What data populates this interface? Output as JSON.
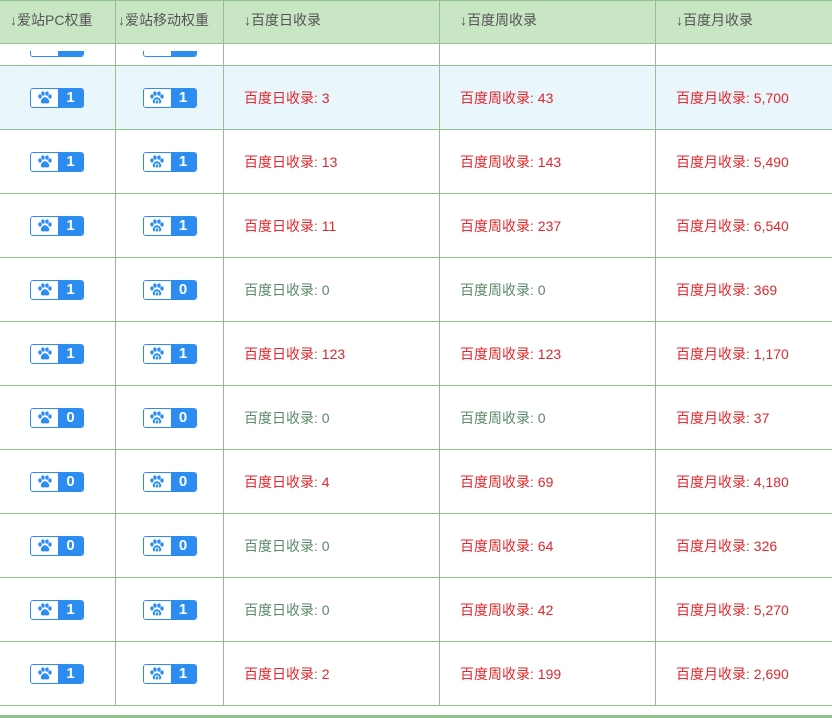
{
  "headers": {
    "pc_weight": "↓爱站PC权重",
    "mobile_weight": "↓爱站移动权重",
    "daily": "↓百度日收录",
    "weekly": "↓百度周收录",
    "monthly": "↓百度月收录"
  },
  "icons": {
    "pc_badge": "paw-icon",
    "mobile_badge": "paw-mobile-icon"
  },
  "colors": {
    "badge_blue": "#2d8cf0",
    "positive_red": "#e0282e",
    "zero_green": "#5a8a6a",
    "header_bg": "#c9e6c4",
    "highlight_bg": "#e9f6fc"
  },
  "rows": [
    {
      "pc": "1",
      "mobile": "1",
      "daily": "百度日收录: 3",
      "weekly": "百度周收录: 43",
      "monthly": "百度月收录: 5,700"
    },
    {
      "pc": "1",
      "mobile": "1",
      "daily": "百度日收录: 13",
      "weekly": "百度周收录: 143",
      "monthly": "百度月收录: 5,490"
    },
    {
      "pc": "1",
      "mobile": "1",
      "daily": "百度日收录: 11",
      "weekly": "百度周收录: 237",
      "monthly": "百度月收录: 6,540"
    },
    {
      "pc": "1",
      "mobile": "0",
      "daily": "百度日收录: 0",
      "weekly": "百度周收录: 0",
      "monthly": "百度月收录: 369"
    },
    {
      "pc": "1",
      "mobile": "1",
      "daily": "百度日收录: 123",
      "weekly": "百度周收录: 123",
      "monthly": "百度月收录: 1,170"
    },
    {
      "pc": "0",
      "mobile": "0",
      "daily": "百度日收录: 0",
      "weekly": "百度周收录: 0",
      "monthly": "百度月收录: 37"
    },
    {
      "pc": "0",
      "mobile": "0",
      "daily": "百度日收录: 4",
      "weekly": "百度周收录: 69",
      "monthly": "百度月收录: 4,180"
    },
    {
      "pc": "0",
      "mobile": "0",
      "daily": "百度日收录: 0",
      "weekly": "百度周收录: 64",
      "monthly": "百度月收录: 326"
    },
    {
      "pc": "1",
      "mobile": "1",
      "daily": "百度日收录: 0",
      "weekly": "百度周收录: 42",
      "monthly": "百度月收录: 5,270"
    },
    {
      "pc": "1",
      "mobile": "1",
      "daily": "百度日收录: 2",
      "weekly": "百度周收录: 199",
      "monthly": "百度月收录: 2,690"
    }
  ]
}
